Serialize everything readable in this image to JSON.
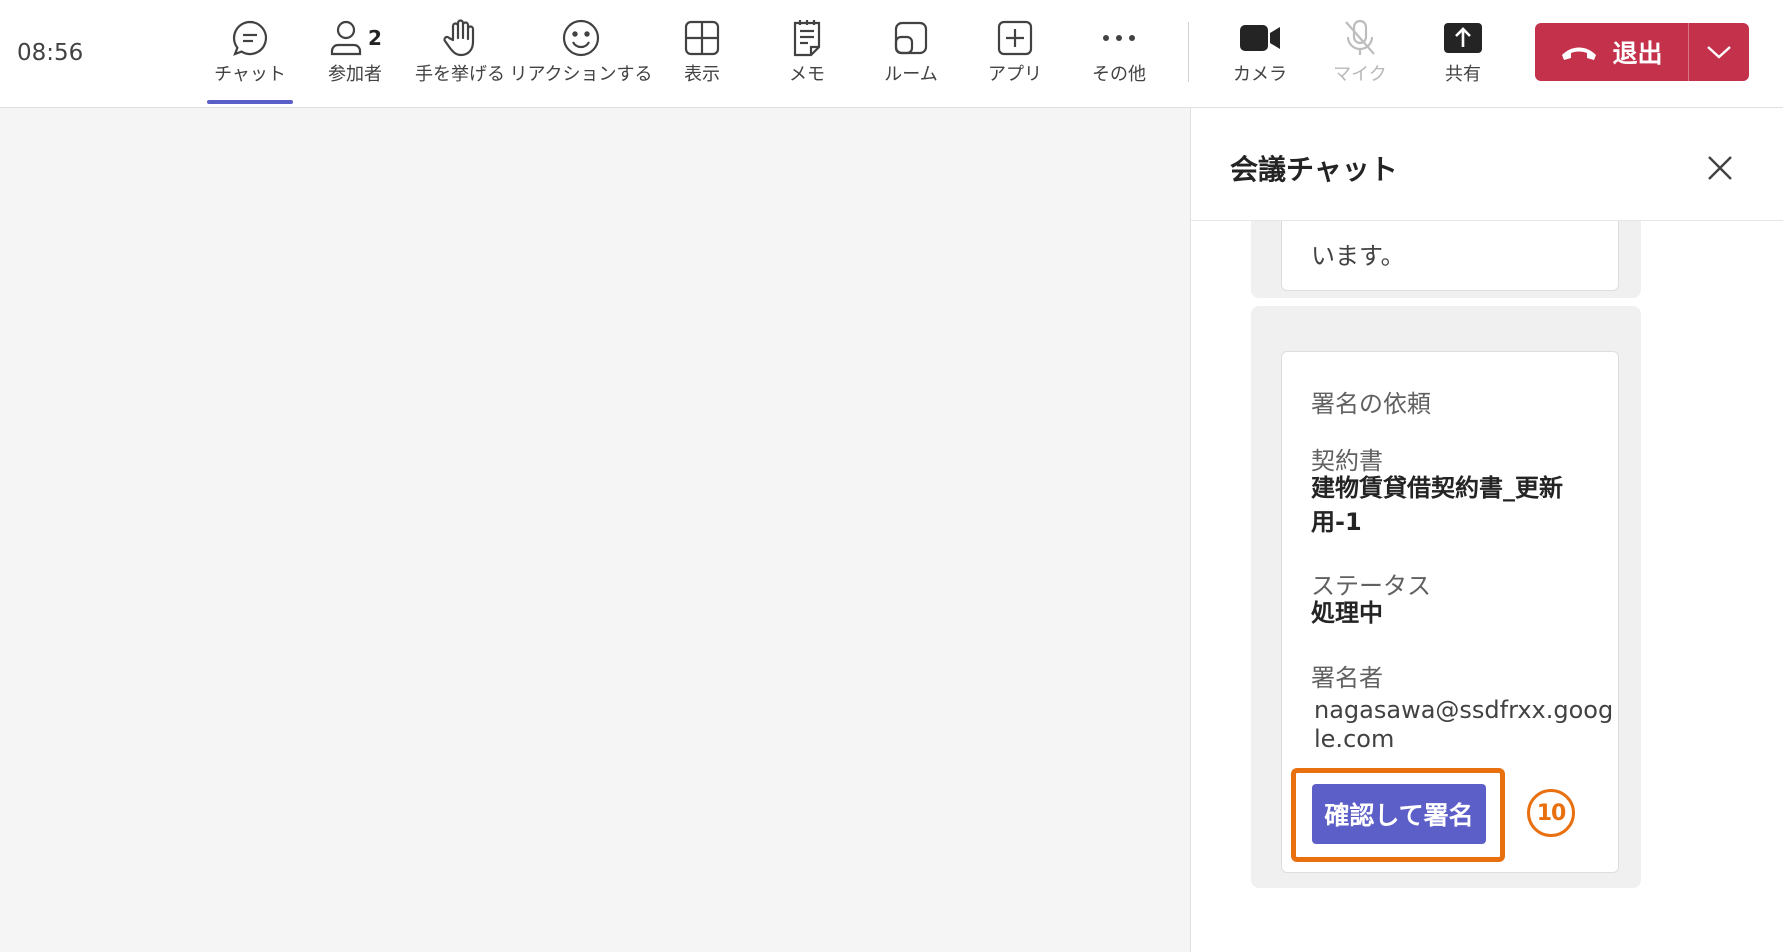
{
  "clock": "08:56",
  "toolbar": {
    "chat": "チャット",
    "people": "参加者",
    "people_count": "2",
    "raise_hand": "手を挙げる",
    "react": "リアクションする",
    "view": "表示",
    "notes": "メモ",
    "rooms": "ルーム",
    "apps": "アプリ",
    "more": "その他",
    "camera": "カメラ",
    "mic": "マイク",
    "share": "共有",
    "leave": "退出"
  },
  "colors": {
    "accent": "#5b5fc7",
    "leave": "#c4314b",
    "highlight": "#e8700f"
  },
  "panel": {
    "title": "会議チャット",
    "previous_message_tail": "います。",
    "card": {
      "header": "署名の依頼",
      "doc_label": "契約書",
      "doc_value": "建物賃貸借契約書_更新用-1",
      "status_label": "ステータス",
      "status_value": "処理中",
      "signer_label": "署名者",
      "signer_value": "nagasawa@ssdfrxx.google.com",
      "sign_button": "確認して署名"
    },
    "step_marker": "10"
  }
}
